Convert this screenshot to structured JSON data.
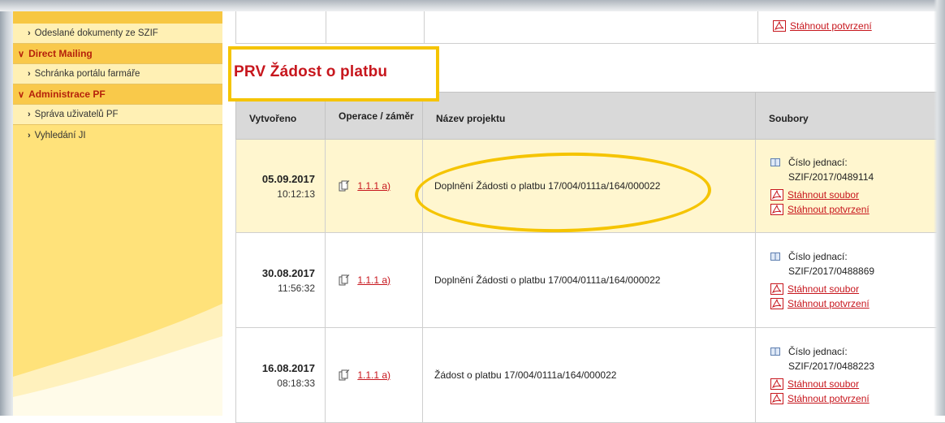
{
  "sidebar": {
    "items": [
      {
        "label": "Odeslané dokumenty ze SZIF",
        "type": "sub"
      },
      {
        "label": "Direct Mailing",
        "type": "head"
      },
      {
        "label": "Schránka portálu farmáře",
        "type": "sub"
      },
      {
        "label": "Administrace PF",
        "type": "head"
      },
      {
        "label": "Správa uživatelů PF",
        "type": "sub"
      },
      {
        "label": "Vyhledání JI",
        "type": "sub"
      }
    ]
  },
  "top_fragment": {
    "download_confirmation": "Stáhnout potvrzení"
  },
  "section": {
    "title": "PRV Žádost o platbu"
  },
  "table": {
    "headers": {
      "created": "Vytvořeno",
      "operation": "Operace / záměr",
      "project": "Název projektu",
      "files": "Soubory"
    },
    "rows": [
      {
        "date": "05.09.2017",
        "time": "10:12:13",
        "operation": "1.1.1 a)",
        "project": "Doplnění Žádosti o platbu 17/004/0111a/164/000022",
        "cj_label": "Číslo jednací:",
        "cj_value": "SZIF/2017/0489114",
        "download_file": "Stáhnout soubor",
        "download_confirmation": "Stáhnout potvrzení"
      },
      {
        "date": "30.08.2017",
        "time": "11:56:32",
        "operation": "1.1.1 a)",
        "project": "Doplnění Žádosti o platbu 17/004/0111a/164/000022",
        "cj_label": "Číslo jednací:",
        "cj_value": "SZIF/2017/0488869",
        "download_file": "Stáhnout soubor",
        "download_confirmation": "Stáhnout potvrzení"
      },
      {
        "date": "16.08.2017",
        "time": "08:18:33",
        "operation": "1.1.1 a)",
        "project": "Žádost o platbu 17/004/0111a/164/000022",
        "cj_label": "Číslo jednací:",
        "cj_value": "SZIF/2017/0488223",
        "download_file": "Stáhnout soubor",
        "download_confirmation": "Stáhnout potvrzení"
      }
    ]
  },
  "colors": {
    "accent_red": "#c7161d",
    "highlight_yellow": "#f5c400",
    "sidebar_yellow": "#ffe27a"
  }
}
